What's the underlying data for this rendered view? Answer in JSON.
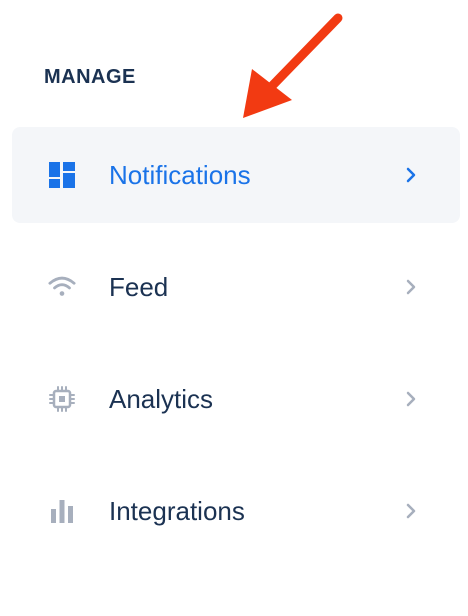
{
  "sidebar": {
    "section_title": "MANAGE",
    "items": [
      {
        "label": "Notifications",
        "icon": "dashboard-icon",
        "active": true
      },
      {
        "label": "Feed",
        "icon": "wifi-icon",
        "active": false
      },
      {
        "label": "Analytics",
        "icon": "chip-icon",
        "active": false
      },
      {
        "label": "Integrations",
        "icon": "bar-chart-icon",
        "active": false
      }
    ]
  },
  "colors": {
    "heading": "#1b3252",
    "active_text": "#1a73e8",
    "inactive_icon": "#a7afbd",
    "active_bg": "#f4f6f9",
    "annotation_arrow": "#f23a12"
  }
}
